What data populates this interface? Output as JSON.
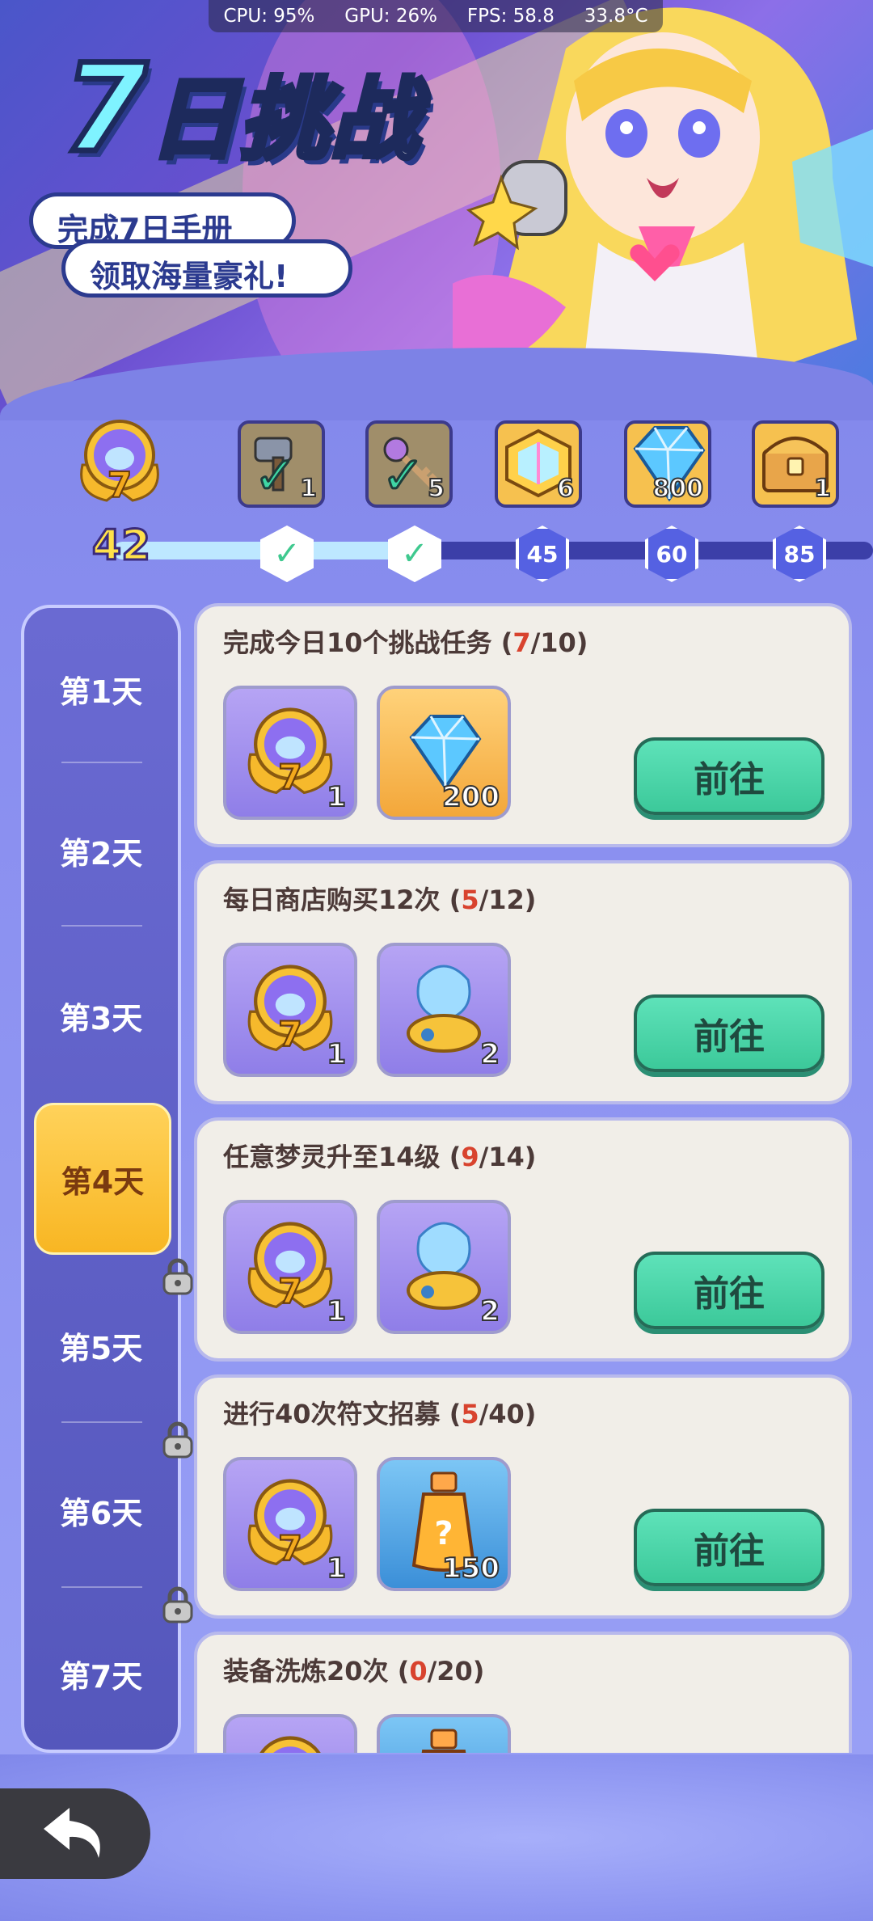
{
  "perf": {
    "cpu": "CPU: 95%",
    "gpu": "GPU: 26%",
    "fps": "FPS: 58.8",
    "temp": "33.8°C"
  },
  "banner": {
    "title_num": "7",
    "title_rest": "日挑战",
    "line1": "完成7日手册",
    "line2": "领取海量豪礼!"
  },
  "progress": {
    "score": "42",
    "fill_fraction": 0.38,
    "milestones": [
      {
        "count": "1",
        "claimed": true,
        "node": "✓",
        "icon": "hammer-icon"
      },
      {
        "count": "5",
        "claimed": true,
        "node": "✓",
        "icon": "key-icon"
      },
      {
        "count": "6",
        "claimed": false,
        "node": "45",
        "icon": "crystal-box-icon"
      },
      {
        "count": "800",
        "claimed": false,
        "node": "60",
        "icon": "diamond-icon"
      },
      {
        "count": "1",
        "claimed": false,
        "node": "85",
        "icon": "treasure-chest-icon"
      }
    ]
  },
  "days": [
    {
      "label": "第1天",
      "locked": false,
      "active": false
    },
    {
      "label": "第2天",
      "locked": false,
      "active": false
    },
    {
      "label": "第3天",
      "locked": false,
      "active": false
    },
    {
      "label": "第4天",
      "locked": false,
      "active": true
    },
    {
      "label": "第5天",
      "locked": true,
      "active": false
    },
    {
      "label": "第6天",
      "locked": true,
      "active": false
    },
    {
      "label": "第7天",
      "locked": true,
      "active": false
    }
  ],
  "tasks": [
    {
      "title": "完成今日10个挑战任务",
      "done": "7",
      "total": "10",
      "rewards": [
        {
          "icon": "badge-medal-icon",
          "count": "1",
          "style": "purple"
        },
        {
          "icon": "diamond-icon",
          "count": "200",
          "style": "gold"
        }
      ],
      "button": "前往"
    },
    {
      "title": "每日商店购买12次",
      "done": "5",
      "total": "12",
      "rewards": [
        {
          "icon": "badge-medal-icon",
          "count": "1",
          "style": "purple"
        },
        {
          "icon": "spirit-jar-icon",
          "count": "2",
          "style": "purple"
        }
      ],
      "button": "前往"
    },
    {
      "title": "任意梦灵升至14级",
      "done": "9",
      "total": "14",
      "rewards": [
        {
          "icon": "badge-medal-icon",
          "count": "1",
          "style": "purple"
        },
        {
          "icon": "spirit-jar-icon",
          "count": "2",
          "style": "purple"
        }
      ],
      "button": "前往"
    },
    {
      "title": "进行40次符文招募",
      "done": "5",
      "total": "40",
      "rewards": [
        {
          "icon": "badge-medal-icon",
          "count": "1",
          "style": "purple"
        },
        {
          "icon": "potion-bottle-icon",
          "count": "150",
          "style": "blue"
        }
      ],
      "button": "前往"
    },
    {
      "title": "装备洗炼20次",
      "done": "0",
      "total": "20",
      "rewards": [
        {
          "icon": "badge-medal-icon",
          "count": "",
          "style": "purple"
        },
        {
          "icon": "potion-bottle-icon",
          "count": "",
          "style": "blue"
        }
      ],
      "button": ""
    }
  ],
  "colors": {
    "accent_green": "#3cc99a",
    "active_day": "#f8b623",
    "progress_red": "#d8432e"
  }
}
